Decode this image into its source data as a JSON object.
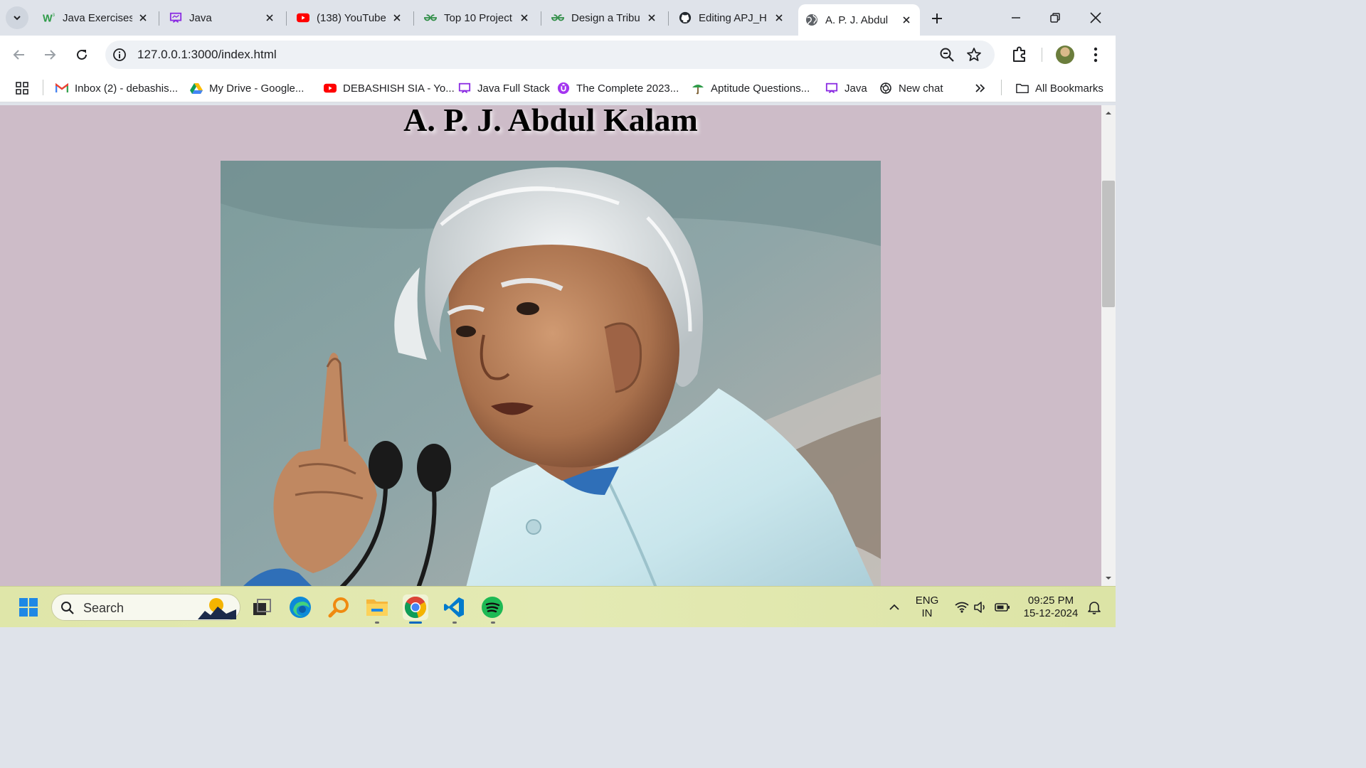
{
  "browser": {
    "tabs": [
      {
        "title": "Java Exercises",
        "icon": "w3resource-icon"
      },
      {
        "title": "Java",
        "icon": "presentation-icon"
      },
      {
        "title": "(138) YouTube",
        "icon": "youtube-icon"
      },
      {
        "title": "Top 10 Project",
        "icon": "geeksforgeeks-icon"
      },
      {
        "title": "Design a Tribu",
        "icon": "geeksforgeeks-icon"
      },
      {
        "title": "Editing APJ_H",
        "icon": "github-icon"
      },
      {
        "title": "A. P. J. Abdul",
        "icon": "globe-icon",
        "active": true
      }
    ],
    "url": "127.0.0.1:3000/index.html",
    "bookmarks": [
      {
        "label": "Inbox (2) - debashis...",
        "icon": "gmail-icon"
      },
      {
        "label": "My Drive - Google...",
        "icon": "google-drive-icon"
      },
      {
        "label": "DEBASHISH SIA - Yo...",
        "icon": "youtube-icon"
      },
      {
        "label": "Java Full Stack",
        "icon": "presentation-icon"
      },
      {
        "label": "The Complete 2023...",
        "icon": "udemy-icon"
      },
      {
        "label": "Aptitude Questions...",
        "icon": "indiabix-icon"
      },
      {
        "label": "Java",
        "icon": "presentation-icon"
      },
      {
        "label": "New chat",
        "icon": "chatgpt-icon"
      }
    ],
    "all_bookmarks_label": "All Bookmarks"
  },
  "page": {
    "title": "A. P. J. Abdul Kalam",
    "background_color": "#cdbcc8"
  },
  "taskbar": {
    "search_label": "Search",
    "language_line1": "ENG",
    "language_line2": "IN",
    "time": "09:25 PM",
    "date": "15-12-2024"
  },
  "colors": {
    "tabstrip": "#dfe3ea",
    "accent_blue": "#0067c0",
    "taskbar": "#e1e8ad"
  }
}
